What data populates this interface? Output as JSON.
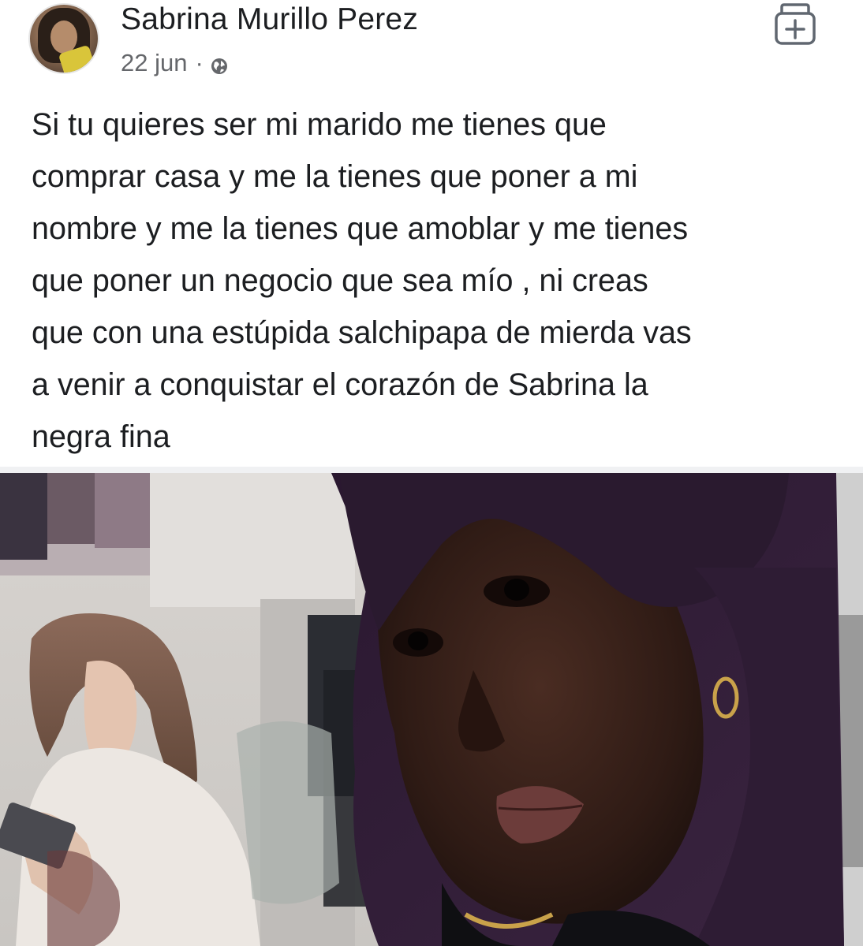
{
  "post": {
    "author": {
      "name": "Sabrina Murillo Perez"
    },
    "date": "22 jun",
    "separator": "·",
    "privacy_icon": "globe-icon",
    "action_icon": "save-icon",
    "text_lines": [
      "Si tu quieres ser mi marido me tienes que",
      "comprar casa y me la tienes que poner a mi",
      "nombre y me la tienes que amoblar y me tienes",
      "que poner un negocio que sea mío , ni creas",
      "que con una estúpida salchipapa de mierda vas",
      "a venir a conquistar el corazón de Sabrina la",
      "negra fina"
    ]
  },
  "colors": {
    "text": "#1c1e21",
    "meta": "#65676b",
    "background": "#ffffff"
  }
}
